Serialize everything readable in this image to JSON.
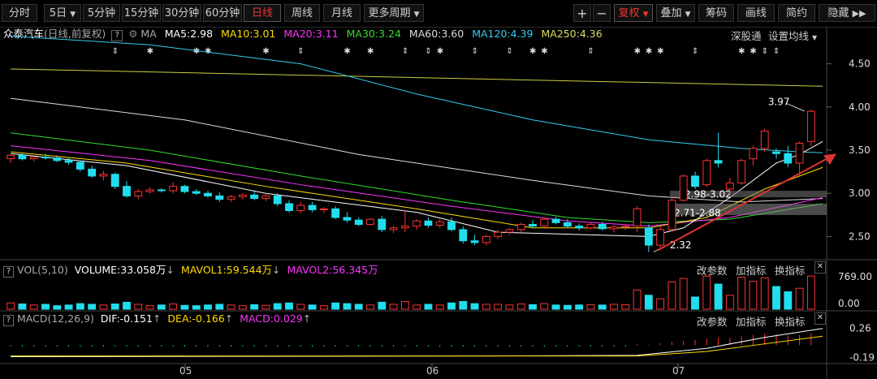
{
  "toolbar": {
    "periods": [
      "分时",
      "5日",
      "5分钟",
      "15分钟",
      "30分钟",
      "60分钟",
      "日线",
      "周线",
      "月线",
      "更多周期"
    ],
    "active_period": "日线",
    "tools": [
      "+",
      "−",
      "复权",
      "叠加",
      "筹码",
      "画线",
      "简约",
      "隐藏"
    ],
    "active_tool": "复权"
  },
  "legend": {
    "stock": "众泰汽车",
    "mode": "(日线,前复权)",
    "ma_label": "MA",
    "ma": [
      {
        "text": "MA5:2.98",
        "color": "#ffffff"
      },
      {
        "text": "MA10:3.01",
        "color": "#ffdd00"
      },
      {
        "text": "MA20:3.11",
        "color": "#ff33ff"
      },
      {
        "text": "MA30:3.24",
        "color": "#33dd33"
      },
      {
        "text": "MA60:3.60",
        "color": "#dddddd"
      },
      {
        "text": "MA120:4.39",
        "color": "#33ccee"
      },
      {
        "text": "MA250:4.36",
        "color": "#dddd66"
      }
    ],
    "links": [
      "深股通",
      "设置均线"
    ]
  },
  "vol_legend": {
    "title": "VOL(5,10)",
    "volume": "VOLUME:33.058万",
    "mavol1": "MAVOL1:59.544万",
    "mavol2": "MAVOL2:56.345万",
    "buttons": [
      "改参数",
      "加指标",
      "换指标"
    ]
  },
  "macd_legend": {
    "title": "MACD(12,26,9)",
    "dif": "DIF:-0.151",
    "dea": "DEA:-0.166",
    "macd": "MACD:0.029",
    "buttons": [
      "改参数",
      "加指标",
      "换指标"
    ]
  },
  "colors": {
    "up": "#ff3333",
    "down": "#22ddee",
    "bg": "#000000",
    "arrow": "#dd3333"
  },
  "chart_data": {
    "type": "candlestick",
    "price_axis": {
      "ticks": [
        4.5,
        4.0,
        3.5,
        3.0,
        2.5
      ],
      "ylim": [
        2.25,
        4.75
      ]
    },
    "x_labels": [
      "05",
      "06",
      "07"
    ],
    "annotations": {
      "high": "3.97",
      "low": "2.32",
      "zone1": "2.98-3.02",
      "zone2": "2.71-2.88"
    },
    "candles": [
      [
        3.4,
        3.45,
        3.35,
        3.44
      ],
      [
        3.44,
        3.46,
        3.38,
        3.4
      ],
      [
        3.4,
        3.43,
        3.37,
        3.42
      ],
      [
        3.42,
        3.46,
        3.39,
        3.41
      ],
      [
        3.41,
        3.44,
        3.36,
        3.38
      ],
      [
        3.38,
        3.41,
        3.33,
        3.36
      ],
      [
        3.36,
        3.38,
        3.25,
        3.28
      ],
      [
        3.28,
        3.32,
        3.18,
        3.2
      ],
      [
        3.2,
        3.26,
        3.15,
        3.22
      ],
      [
        3.22,
        3.24,
        3.05,
        3.08
      ],
      [
        3.08,
        3.14,
        2.95,
        2.97
      ],
      [
        2.97,
        3.05,
        2.93,
        3.02
      ],
      [
        3.02,
        3.07,
        3.0,
        3.04
      ],
      [
        3.04,
        3.06,
        3.01,
        3.03
      ],
      [
        3.03,
        3.13,
        3.0,
        3.08
      ],
      [
        3.08,
        3.1,
        3.0,
        3.02
      ],
      [
        3.02,
        3.05,
        2.98,
        3.0
      ],
      [
        3.0,
        3.03,
        2.95,
        2.97
      ],
      [
        2.97,
        3.01,
        2.9,
        2.93
      ],
      [
        2.93,
        2.98,
        2.9,
        2.96
      ],
      [
        2.96,
        3.0,
        2.93,
        2.98
      ],
      [
        2.98,
        3.02,
        2.92,
        2.94
      ],
      [
        2.94,
        2.99,
        2.91,
        2.97
      ],
      [
        2.97,
        3.0,
        2.85,
        2.88
      ],
      [
        2.88,
        2.92,
        2.78,
        2.8
      ],
      [
        2.8,
        2.9,
        2.77,
        2.86
      ],
      [
        2.86,
        2.9,
        2.78,
        2.81
      ],
      [
        2.81,
        2.84,
        2.77,
        2.82
      ],
      [
        2.82,
        2.85,
        2.7,
        2.72
      ],
      [
        2.72,
        2.78,
        2.66,
        2.69
      ],
      [
        2.69,
        2.72,
        2.62,
        2.64
      ],
      [
        2.64,
        2.71,
        2.63,
        2.7
      ],
      [
        2.7,
        2.74,
        2.55,
        2.58
      ],
      [
        2.58,
        2.62,
        2.54,
        2.6
      ],
      [
        2.6,
        2.8,
        2.55,
        2.62
      ],
      [
        2.62,
        2.7,
        2.58,
        2.68
      ],
      [
        2.68,
        2.72,
        2.6,
        2.63
      ],
      [
        2.63,
        2.7,
        2.6,
        2.67
      ],
      [
        2.67,
        2.72,
        2.56,
        2.58
      ],
      [
        2.58,
        2.62,
        2.42,
        2.45
      ],
      [
        2.45,
        2.52,
        2.4,
        2.43
      ],
      [
        2.43,
        2.52,
        2.4,
        2.5
      ],
      [
        2.5,
        2.58,
        2.47,
        2.55
      ],
      [
        2.55,
        2.6,
        2.52,
        2.58
      ],
      [
        2.58,
        2.66,
        2.55,
        2.64
      ],
      [
        2.64,
        2.69,
        2.6,
        2.62
      ],
      [
        2.62,
        2.72,
        2.59,
        2.7
      ],
      [
        2.7,
        2.73,
        2.64,
        2.66
      ],
      [
        2.66,
        2.7,
        2.6,
        2.62
      ],
      [
        2.62,
        2.65,
        2.57,
        2.6
      ],
      [
        2.6,
        2.66,
        2.58,
        2.64
      ],
      [
        2.64,
        2.67,
        2.57,
        2.59
      ],
      [
        2.59,
        2.63,
        2.55,
        2.61
      ],
      [
        2.61,
        2.64,
        2.58,
        2.62
      ],
      [
        2.62,
        2.85,
        2.55,
        2.82
      ],
      [
        2.6,
        2.64,
        2.32,
        2.4
      ],
      [
        2.4,
        2.62,
        2.37,
        2.58
      ],
      [
        2.58,
        2.95,
        2.56,
        2.92
      ],
      [
        2.92,
        3.22,
        2.9,
        3.2
      ],
      [
        3.2,
        3.25,
        3.05,
        3.08
      ],
      [
        3.1,
        3.4,
        3.07,
        3.38
      ],
      [
        3.38,
        3.7,
        3.3,
        3.35
      ],
      [
        3.05,
        3.18,
        2.98,
        3.12
      ],
      [
        3.12,
        3.4,
        3.1,
        3.38
      ],
      [
        3.4,
        3.55,
        3.32,
        3.52
      ],
      [
        3.52,
        3.75,
        3.48,
        3.72
      ],
      [
        3.48,
        3.52,
        3.4,
        3.46
      ],
      [
        3.46,
        3.55,
        3.3,
        3.35
      ],
      [
        3.35,
        3.6,
        3.2,
        3.58
      ],
      [
        3.6,
        3.97,
        3.55,
        3.95
      ]
    ],
    "ma_series": [
      {
        "name": "MA250",
        "color": "#cccc44",
        "points": [
          [
            0,
            4.44
          ],
          [
            70,
            4.24
          ]
        ]
      },
      {
        "name": "MA120",
        "color": "#33ccee",
        "points": [
          [
            0,
            4.82
          ],
          [
            12,
            4.72
          ],
          [
            25,
            4.5
          ],
          [
            35,
            4.15
          ],
          [
            45,
            3.85
          ],
          [
            55,
            3.62
          ],
          [
            63,
            3.52
          ],
          [
            68,
            3.48
          ],
          [
            70,
            3.47
          ]
        ]
      },
      {
        "name": "MA60",
        "color": "#dddddd",
        "points": [
          [
            0,
            4.1
          ],
          [
            15,
            3.85
          ],
          [
            30,
            3.45
          ],
          [
            45,
            3.15
          ],
          [
            55,
            2.97
          ],
          [
            63,
            2.9
          ],
          [
            70,
            2.94
          ]
        ]
      },
      {
        "name": "MA30",
        "color": "#33dd33",
        "points": [
          [
            0,
            3.7
          ],
          [
            12,
            3.5
          ],
          [
            25,
            3.2
          ],
          [
            38,
            2.92
          ],
          [
            48,
            2.72
          ],
          [
            55,
            2.66
          ],
          [
            62,
            2.7
          ],
          [
            70,
            2.88
          ]
        ]
      },
      {
        "name": "MA20",
        "color": "#ff33ff",
        "points": [
          [
            0,
            3.55
          ],
          [
            12,
            3.38
          ],
          [
            25,
            3.1
          ],
          [
            38,
            2.85
          ],
          [
            48,
            2.68
          ],
          [
            55,
            2.62
          ],
          [
            62,
            2.72
          ],
          [
            70,
            2.95
          ]
        ]
      },
      {
        "name": "MA10",
        "color": "#ffdd00",
        "points": [
          [
            0,
            3.48
          ],
          [
            10,
            3.35
          ],
          [
            22,
            3.08
          ],
          [
            35,
            2.82
          ],
          [
            45,
            2.6
          ],
          [
            55,
            2.6
          ],
          [
            60,
            2.72
          ],
          [
            65,
            3.05
          ],
          [
            70,
            3.3
          ]
        ]
      },
      {
        "name": "MA5",
        "color": "#ffffff",
        "points": [
          [
            0,
            3.46
          ],
          [
            10,
            3.32
          ],
          [
            22,
            3.0
          ],
          [
            35,
            2.78
          ],
          [
            42,
            2.55
          ],
          [
            55,
            2.5
          ],
          [
            58,
            2.6
          ],
          [
            62,
            2.95
          ],
          [
            66,
            3.35
          ],
          [
            68,
            3.45
          ],
          [
            70,
            3.6
          ]
        ]
      }
    ],
    "volume": [
      18,
      15,
      12,
      14,
      10,
      12,
      16,
      14,
      12,
      15,
      20,
      14,
      10,
      12,
      15,
      11,
      10,
      12,
      14,
      12,
      10,
      13,
      11,
      16,
      18,
      14,
      12,
      10,
      18,
      16,
      14,
      12,
      20,
      14,
      22,
      12,
      14,
      12,
      18,
      22,
      16,
      14,
      14,
      12,
      15,
      13,
      16,
      12,
      11,
      12,
      13,
      12,
      14,
      13,
      55,
      40,
      30,
      78,
      88,
      35,
      95,
      72,
      40,
      92,
      80,
      90,
      65,
      50,
      60,
      95
    ],
    "vol_axis": {
      "ticks": [
        769.0,
        0.0
      ],
      "ylim": [
        0,
        769
      ]
    },
    "macd_axis": {
      "ticks": [
        0.26,
        -0.19
      ],
      "ylim": [
        -0.25,
        0.32
      ]
    },
    "macd_bars": [
      -0.02,
      -0.02,
      -0.02,
      -0.02,
      -0.02,
      -0.02,
      -0.02,
      -0.02,
      -0.02,
      -0.02,
      -0.02,
      -0.02,
      -0.02,
      -0.02,
      -0.02,
      -0.02,
      -0.02,
      -0.02,
      -0.02,
      -0.02,
      -0.02,
      -0.02,
      -0.02,
      -0.02,
      -0.02,
      -0.02,
      -0.02,
      -0.02,
      -0.02,
      -0.02,
      -0.02,
      -0.02,
      -0.02,
      -0.02,
      -0.02,
      -0.02,
      -0.02,
      -0.02,
      -0.02,
      -0.02,
      -0.02,
      -0.02,
      -0.02,
      -0.02,
      -0.02,
      -0.02,
      -0.02,
      -0.02,
      -0.02,
      -0.02,
      -0.02,
      -0.02,
      -0.02,
      -0.02,
      0.02,
      0.01,
      0.03,
      0.05,
      0.07,
      0.08,
      0.1,
      0.12,
      0.11,
      0.14,
      0.16,
      0.18,
      0.17,
      0.15,
      0.16,
      0.18
    ],
    "dif": [
      [
        0,
        -0.18
      ],
      [
        40,
        -0.17
      ],
      [
        54,
        -0.16
      ],
      [
        60,
        -0.05
      ],
      [
        65,
        0.12
      ],
      [
        70,
        0.26
      ]
    ],
    "dea": [
      [
        0,
        -0.17
      ],
      [
        40,
        -0.17
      ],
      [
        54,
        -0.17
      ],
      [
        60,
        -0.1
      ],
      [
        65,
        0.02
      ],
      [
        70,
        0.14
      ]
    ]
  }
}
